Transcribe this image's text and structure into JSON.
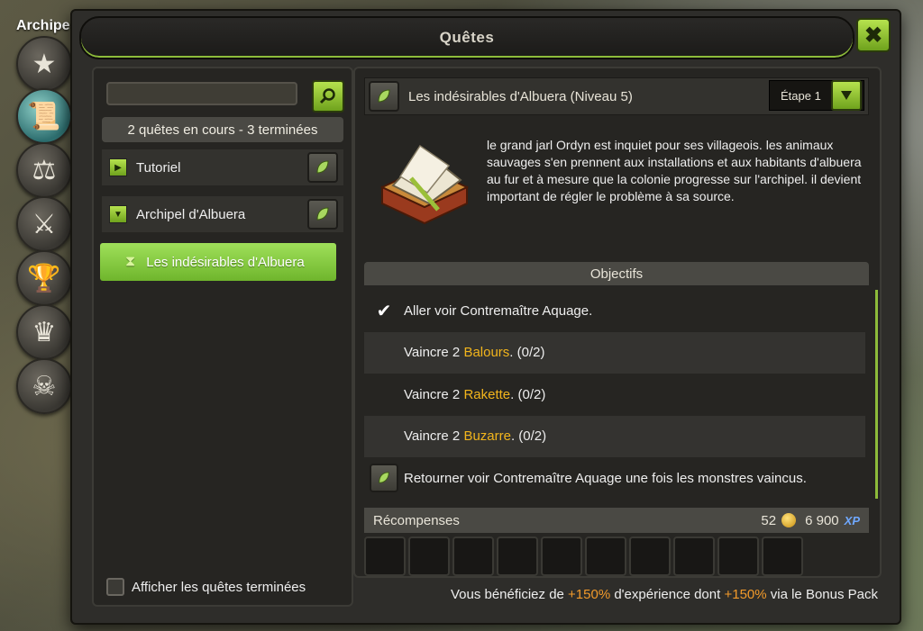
{
  "hud": {
    "title": "Archipe",
    "buttons": [
      "wand-icon",
      "scroll-icon",
      "scales-icon",
      "axes-icon",
      "trophy-icon",
      "crown-icon",
      "helmet-icon"
    ]
  },
  "window": {
    "title": "Quêtes",
    "close_label": "✖"
  },
  "left": {
    "search_placeholder": "",
    "count_label": "2 quêtes en cours - 3 terminées",
    "categories": [
      {
        "label": "Tutoriel",
        "expanded": false
      },
      {
        "label": "Archipel d'Albuera",
        "expanded": true
      }
    ],
    "selected_quest": "Les indésirables d'Albuera",
    "show_finished_label": "Afficher les quêtes terminées"
  },
  "quest": {
    "title": "Les indésirables d'Albuera (Niveau 5)",
    "step_label": "Étape 1",
    "description": "le grand jarl Ordyn est inquiet pour ses villageois. les animaux sauvages s'en prennent aux installations et aux habitants d'albuera au fur et à mesure que la colonie progresse sur l'archipel. il devient important de régler le problème à sa source.",
    "objectives_header": "Objectifs",
    "objectives": [
      {
        "prefix": "Aller voir Contremaître Aquage.",
        "monster": "",
        "suffix": "",
        "done": true
      },
      {
        "prefix": "Vaincre 2 ",
        "monster": "Balours",
        "suffix": ". (0/2)",
        "done": false
      },
      {
        "prefix": "Vaincre 2 ",
        "monster": "Rakette",
        "suffix": ". (0/2)",
        "done": false
      },
      {
        "prefix": "Vaincre 2 ",
        "monster": "Buzarre",
        "suffix": ". (0/2)",
        "done": false
      },
      {
        "prefix": "Retourner voir Contremaître Aquage une fois les monstres vaincus.",
        "monster": "",
        "suffix": "",
        "done": false,
        "leaf": true
      }
    ],
    "rewards_label": "Récompenses",
    "kamas": "52",
    "xp_value": "6 900",
    "xp_label": "XP",
    "slot_count": 10
  },
  "bonus": {
    "prefix": "Vous bénéficiez de ",
    "pct1": "+150%",
    "middle": " d'expérience dont ",
    "pct2": "+150%",
    "suffix": " via le Bonus Pack"
  },
  "colors": {
    "accent_green": "#8dbb3a",
    "monster_yellow": "#f2b51c",
    "bonus_orange": "#f29a2a",
    "xp_blue": "#6fa8ff"
  }
}
